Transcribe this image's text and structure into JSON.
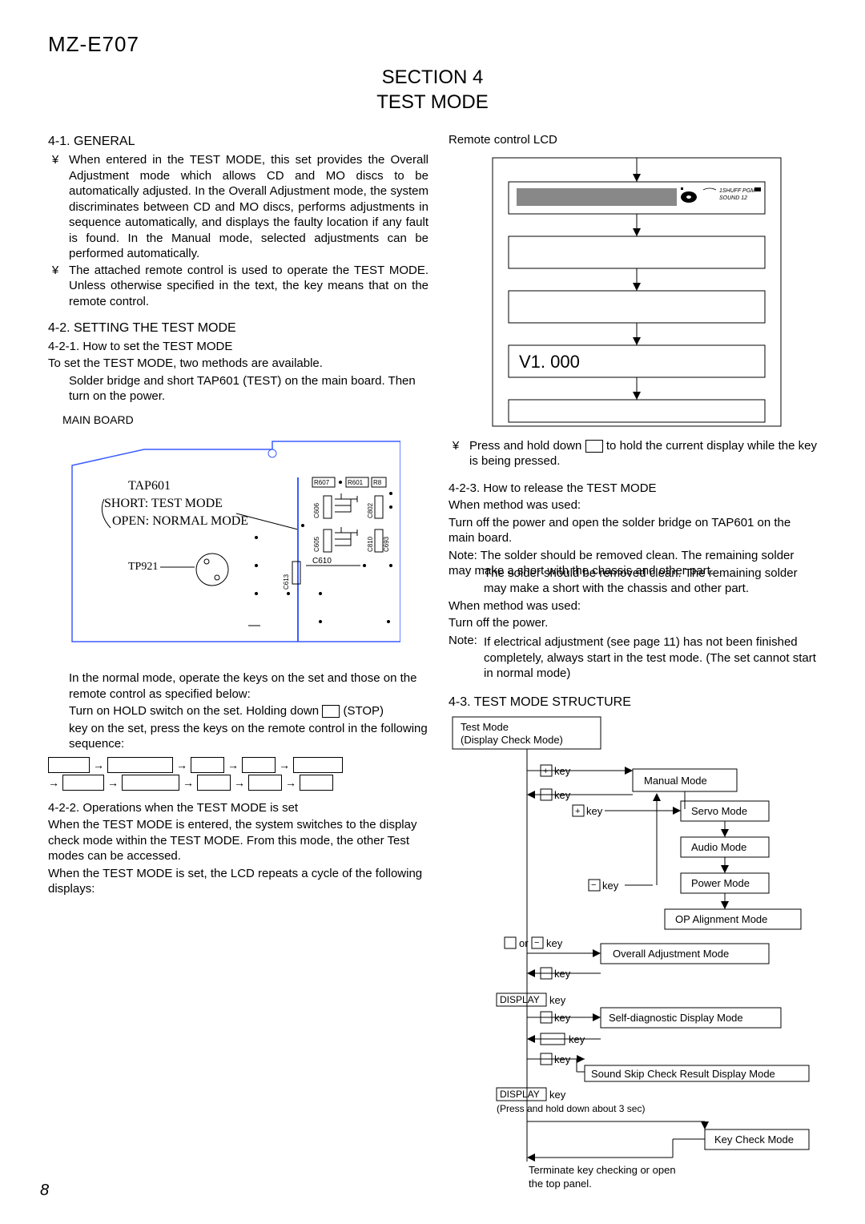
{
  "model": "MZ-E707",
  "section_title_l1": "SECTION 4",
  "section_title_l2": "TEST MODE",
  "h_general": "4-1. GENERAL",
  "general_b1": "When entered in the TEST MODE, this set provides the Overall Adjustment mode which allows CD and MO discs to be automatically adjusted. In the Overall Adjustment mode, the system discriminates between CD and MO discs, performs adjustments in sequence automatically, and displays the faulty location if any fault is found. In the Manual mode, selected adjustments can be performed automatically.",
  "general_b2": "The attached remote control is used to operate the TEST MODE. Unless otherwise specified in the text, the key means that on the remote control.",
  "h_setting": "4-2. SETTING THE TEST MODE",
  "h_howset": "4-2-1. How to set the TEST MODE",
  "howset_l1": "To set the TEST MODE, two methods are available.",
  "howset_l2": "Solder bridge and short TAP601 (TEST) on the main board. Then turn on the power.",
  "mainboard_label": "MAIN BOARD",
  "mb_tap601": "TAP601",
  "mb_short": "SHORT: TEST MODE",
  "mb_open": "OPEN: NORMAL MODE",
  "mb_tp921": "TP921",
  "mb_r607": "R607",
  "mb_r601": "R601",
  "mb_r8": "R8",
  "mb_c606": "C606",
  "mb_c605": "C605",
  "mb_c613": "C613",
  "mb_c610": "C610",
  "mb_c802": "C802",
  "mb_c810": "C810",
  "mb_c693": "C693",
  "normal_l1": "In the normal mode, operate the keys on the set and those on the remote control as specified below:",
  "normal_l2a": "Turn on HOLD switch on the set. Holding down",
  "normal_l2b": "(STOP)",
  "normal_l3": "key on the set, press the keys on the remote control in the following sequence:",
  "h_ops": "4-2-2. Operations when the TEST MODE is set",
  "ops_p1": "When the TEST MODE is entered, the system switches to the display check mode within the TEST MODE. From this mode, the other Test modes can be accessed.",
  "ops_p2": "When the TEST MODE is set, the LCD repeats a cycle of the following displays:",
  "remote_lcd_label": "Remote control LCD",
  "lcd_v1": "V1. 000",
  "lcd_top_txt": "1SHUFF PGM",
  "lcd_top_txt2": "SOUND 12",
  "press_hold_a": "Press and hold down",
  "press_hold_b": "to hold the current display while the key is being pressed.",
  "h_release": "4-2-3. How to release the TEST MODE",
  "rel_m1": "When method   was used:",
  "rel_m1_t": "Turn off the power and open the solder bridge on TAP601 on the main board.",
  "rel_note1a": "Note:",
  "rel_note1b": "The solder should be removed clean. The remaining solder may make a short with the chassis and other part.",
  "rel_m2": "When method   was used:",
  "rel_m2_t": "Turn off the power.",
  "rel_note2b": "If electrical adjustment (see page 11) has not been finished completely, always start in the test mode. (The set cannot start in normal mode)",
  "h_struct": "4-3. TEST MODE STRUCTURE",
  "s_testmode": "Test Mode",
  "s_display_check": "(Display Check Mode)",
  "s_plus_key": "key",
  "s_manual": "Manual Mode",
  "s_servo": "Servo Mode",
  "s_audio": "Audio Mode",
  "s_power": "Power Mode",
  "s_op": "OP Alignment Mode",
  "s_overall": "Overall Adjustment Mode",
  "s_display_key": "DISPLAY",
  "s_self": "Self-diagnostic Display Mode",
  "s_skip": "Sound Skip Check Result Display Mode",
  "s_press_hold": "(Press and hold down about 3 sec)",
  "s_keycheck": "Key Check Mode",
  "s_terminate": "Terminate key checking or open the top panel.",
  "s_or": "or",
  "s_key": "key",
  "page_num": "8"
}
